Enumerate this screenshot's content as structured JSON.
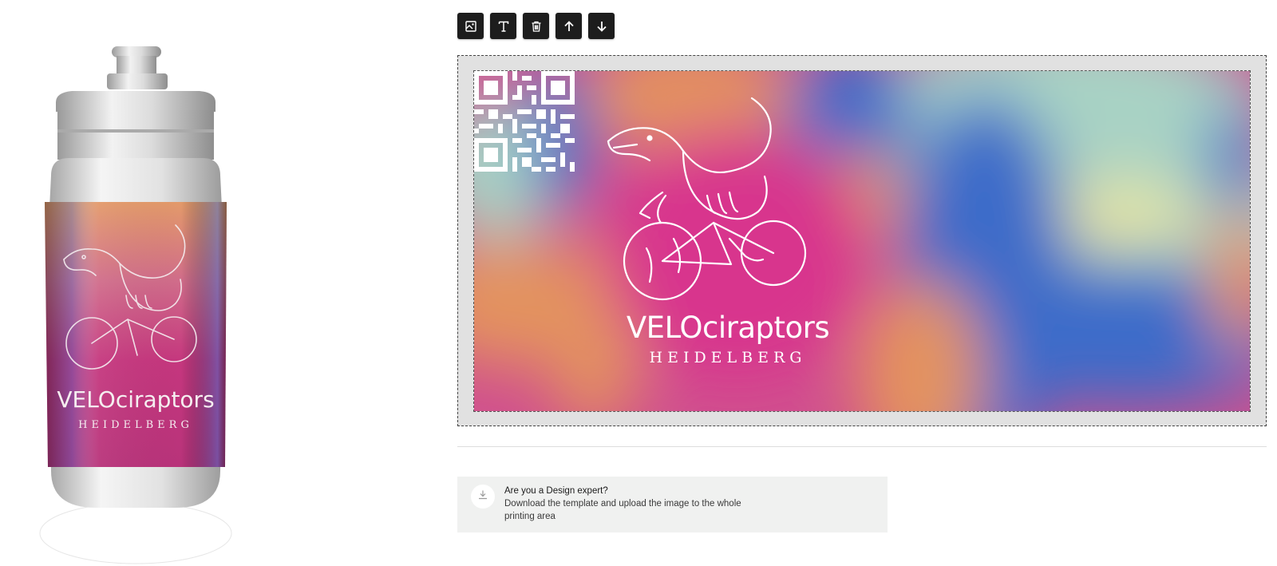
{
  "toolbar": {
    "buttons": [
      {
        "icon": "add-image-icon",
        "label": ""
      },
      {
        "icon": "add-text-icon",
        "label": ""
      },
      {
        "icon": "trash-icon",
        "label": ""
      },
      {
        "icon": "arrow-up-icon",
        "label": ""
      },
      {
        "icon": "arrow-down-icon",
        "label": ""
      }
    ]
  },
  "design": {
    "title": "VELOciraptors",
    "subtitle": "HEIDELBERG",
    "colors": {
      "pink": "#d8348d",
      "orange": "#e3935e",
      "blue": "#3c6cc9",
      "mint": "#a8d2c4",
      "yellow": "#e7e5a0"
    }
  },
  "info_card": {
    "icon": "download-icon",
    "title": "Are you a Design expert?",
    "body": "Download the template and upload the image to the whole printing area"
  }
}
